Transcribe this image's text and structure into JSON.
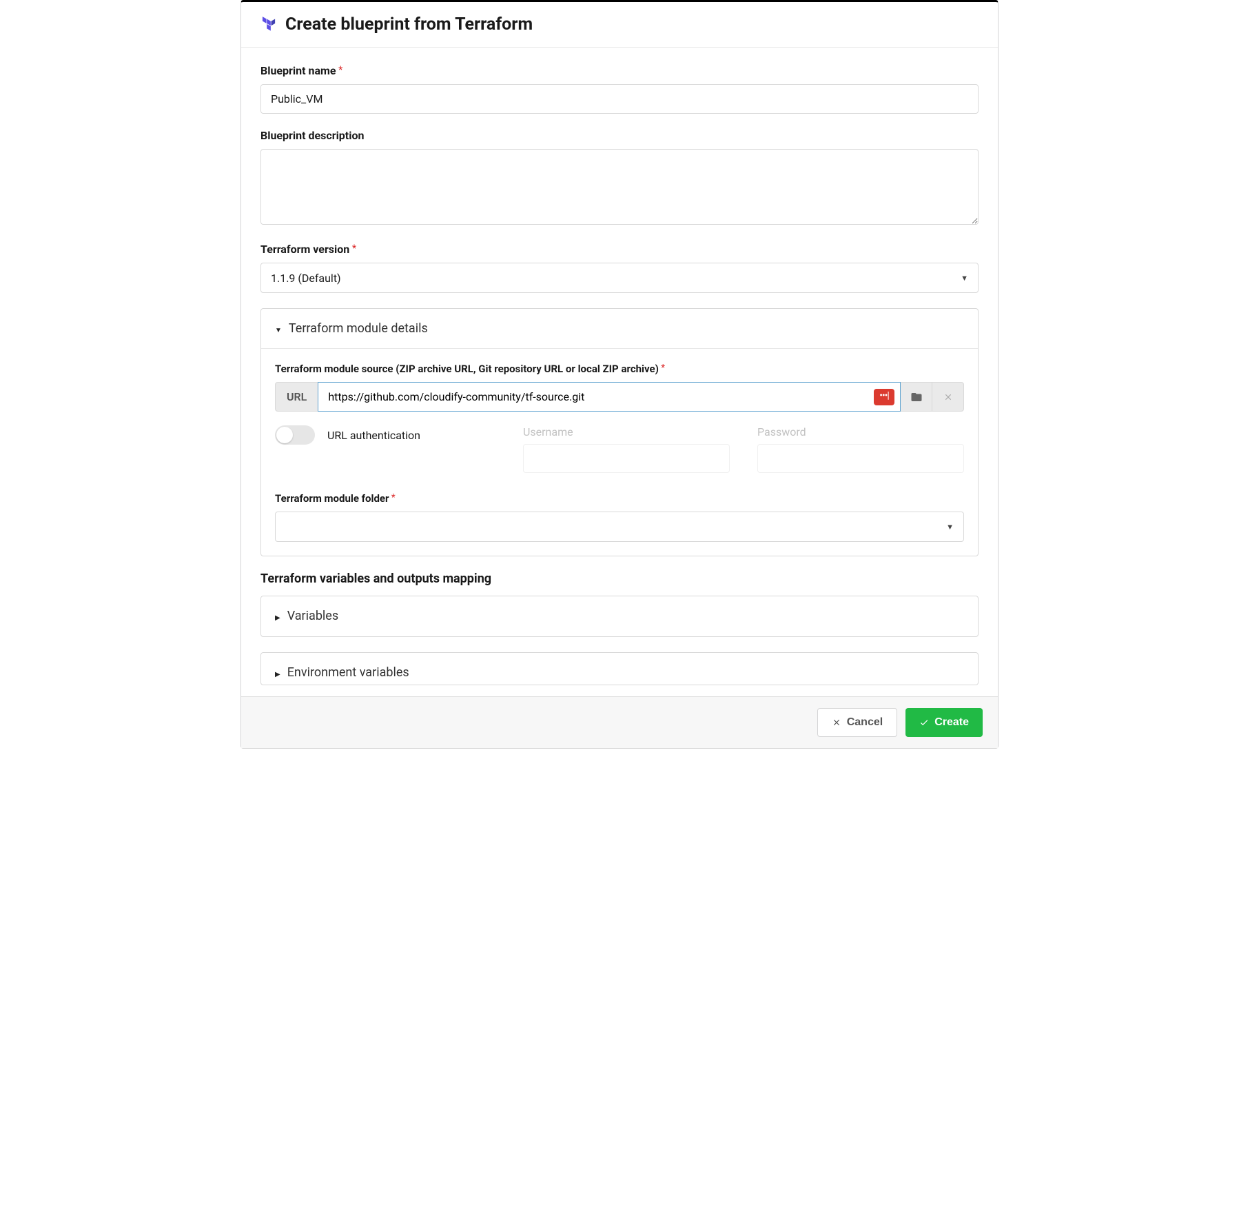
{
  "header": {
    "title": "Create blueprint from Terraform"
  },
  "fields": {
    "blueprint_name_label": "Blueprint name",
    "blueprint_name_value": "Public_VM",
    "blueprint_description_label": "Blueprint description",
    "blueprint_description_value": "",
    "terraform_version_label": "Terraform version",
    "terraform_version_value": "1.1.9 (Default)"
  },
  "module": {
    "section_title": "Terraform module details",
    "source_label": "Terraform module source (ZIP archive URL, Git repository URL or local ZIP archive)",
    "url_prefix": "URL",
    "url_value": "https://github.com/cloudify-community/tf-source.git",
    "auth_label": "URL authentication",
    "username_label": "Username",
    "username_value": "",
    "password_label": "Password",
    "password_value": "",
    "folder_label": "Terraform module folder",
    "folder_value": ""
  },
  "variables_section": {
    "heading": "Terraform variables and outputs mapping",
    "variables_title": "Variables",
    "env_variables_title": "Environment variables"
  },
  "footer": {
    "cancel_label": "Cancel",
    "create_label": "Create"
  }
}
